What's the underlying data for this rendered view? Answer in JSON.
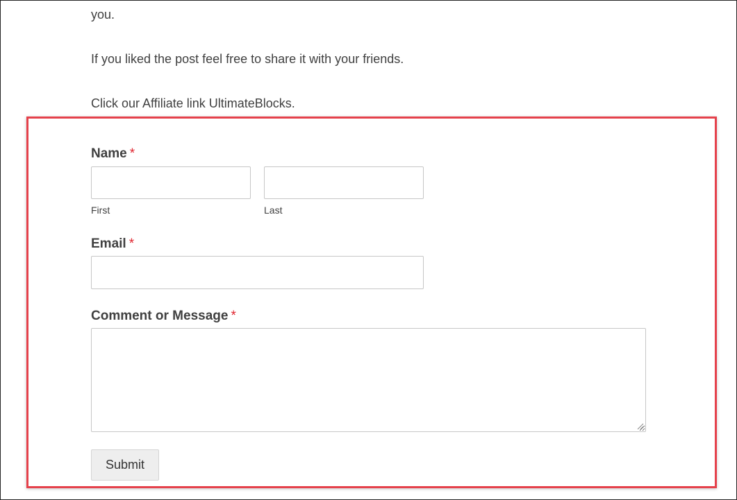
{
  "content": {
    "paragraphs": [
      "you.",
      "If you liked the post feel free to share it with your friends.",
      "Click our Affiliate link UltimateBlocks."
    ]
  },
  "form": {
    "name": {
      "label": "Name",
      "required_mark": "*",
      "first_value": "",
      "last_value": "",
      "first_sublabel": "First",
      "last_sublabel": "Last"
    },
    "email": {
      "label": "Email",
      "required_mark": "*",
      "value": ""
    },
    "comment": {
      "label": "Comment or Message",
      "required_mark": "*",
      "value": ""
    },
    "submit_label": "Submit"
  },
  "colors": {
    "highlight_border": "#e5414b",
    "required_asterisk": "#e0242e",
    "text": "#404040"
  }
}
